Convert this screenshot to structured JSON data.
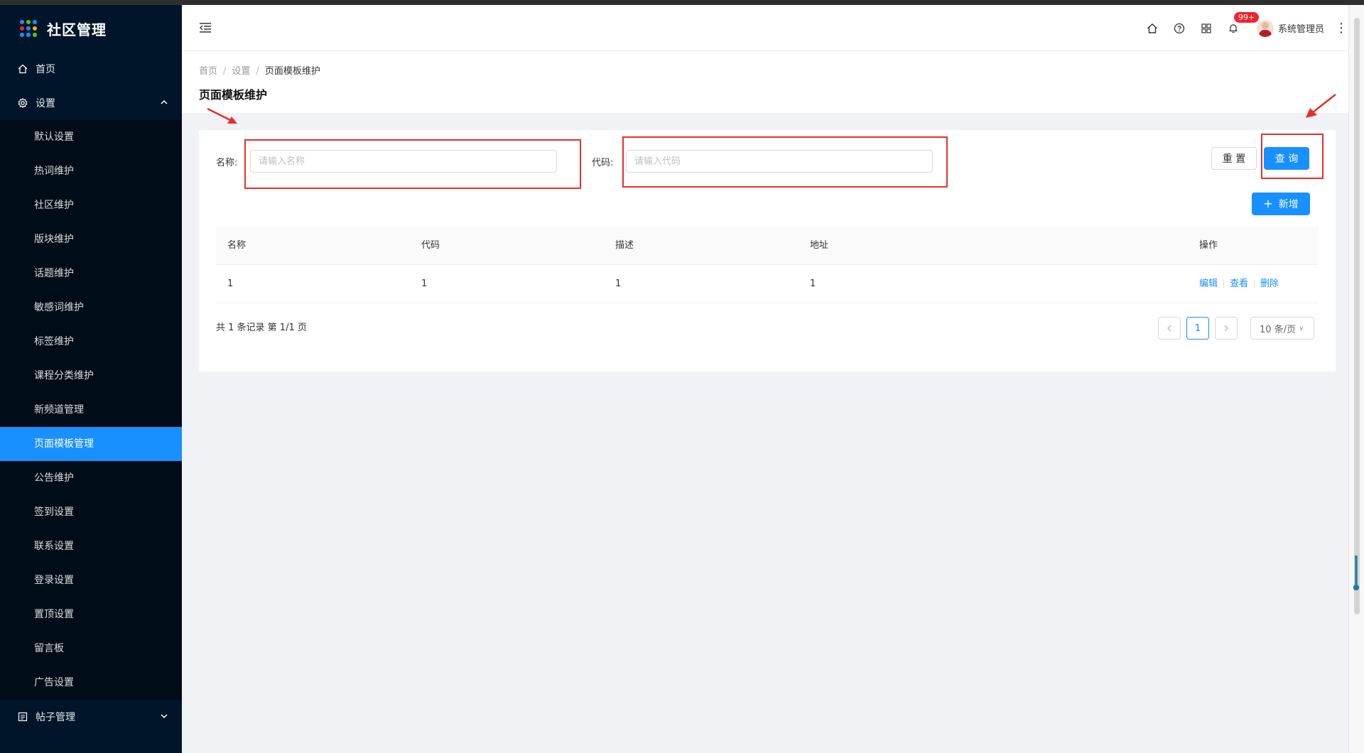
{
  "app": {
    "title": "社区管理"
  },
  "colors": {
    "sidebar_bg": "#001529",
    "primary": "#1890ff",
    "annotation_red": "#e5302d",
    "badge_red": "#f5222d"
  },
  "sidebar": {
    "home": {
      "label": "首页",
      "icon": "home-icon"
    },
    "settings": {
      "label": "设置",
      "icon": "gear-icon",
      "expanded": true
    },
    "settings_items": [
      {
        "label": "默认设置"
      },
      {
        "label": "热词维护"
      },
      {
        "label": "社区维护"
      },
      {
        "label": "版块维护"
      },
      {
        "label": "话题维护"
      },
      {
        "label": "敏感词维护"
      },
      {
        "label": "标签维护"
      },
      {
        "label": "课程分类维护"
      },
      {
        "label": "新频道管理"
      },
      {
        "label": "页面模板管理",
        "active": true
      },
      {
        "label": "公告维护"
      },
      {
        "label": "签到设置"
      },
      {
        "label": "联系设置"
      },
      {
        "label": "登录设置"
      },
      {
        "label": "置顶设置"
      },
      {
        "label": "留言板"
      },
      {
        "label": "广告设置"
      }
    ],
    "posts": {
      "label": "帖子管理",
      "icon": "list-icon",
      "expanded": false
    }
  },
  "header": {
    "notification_count": "99+",
    "username": "系统管理员"
  },
  "breadcrumb": [
    "首页",
    "设置",
    "页面模板维护"
  ],
  "page_title": "页面模板维护",
  "search_form": {
    "name_label": "名称:",
    "name_placeholder": "请输入名称",
    "name_value": "",
    "code_label": "代码:",
    "code_placeholder": "请输入代码",
    "code_value": "",
    "reset_label": "重 置",
    "query_label": "查 询"
  },
  "add_button": {
    "label": "新增"
  },
  "table": {
    "columns": [
      "名称",
      "代码",
      "描述",
      "地址",
      "操作"
    ],
    "rows": [
      {
        "name": "1",
        "code": "1",
        "description": "1",
        "address": "1",
        "actions": [
          "编辑",
          "查看",
          "删除"
        ]
      }
    ]
  },
  "pagination": {
    "summary": "共 1 条记录 第 1/1 页",
    "current_page": "1",
    "page_size": "10 条/页"
  }
}
